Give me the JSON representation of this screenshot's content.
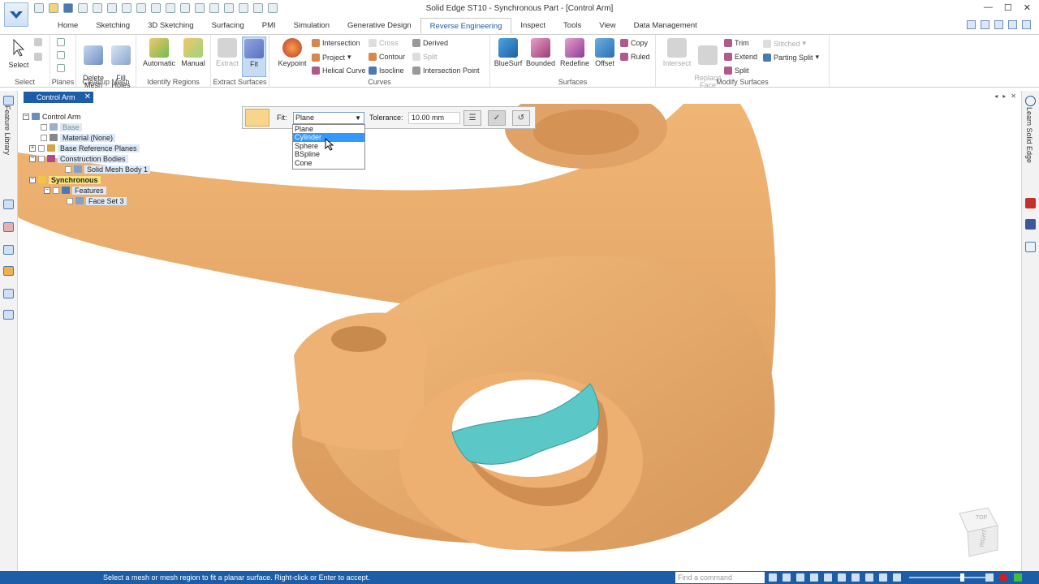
{
  "window": {
    "title": "Solid Edge ST10 - Synchronous Part - [Control Arm]",
    "controls": [
      "—",
      "☐",
      "✕"
    ]
  },
  "tabs": [
    "Home",
    "Sketching",
    "3D Sketching",
    "Surfacing",
    "PMI",
    "Simulation",
    "Generative Design",
    "Reverse Engineering",
    "Inspect",
    "Tools",
    "View",
    "Data Management"
  ],
  "active_tab": "Reverse Engineering",
  "ribbon": {
    "select": {
      "label": "Select",
      "group": "Select"
    },
    "planes": {
      "label": "Planes"
    },
    "cleanup": {
      "delete_mesh": "Delete\nMesh",
      "fill_holes": "Fill\nHoles",
      "group": "Cleanup Mesh"
    },
    "identify": {
      "automatic": "Automatic",
      "manual": "Manual",
      "group": "Identify Regions"
    },
    "extract": {
      "extract": "Extract",
      "fit": "Fit",
      "group": "Extract Surfaces"
    },
    "curves": {
      "keypoint": "Keypoint",
      "intersection": "Intersection",
      "project": "Project",
      "helical": "Helical Curve",
      "cross": "Cross",
      "contour": "Contour",
      "isocline": "Isocline",
      "derived": "Derived",
      "split": "Split",
      "intersection_point": "Intersection Point",
      "group": "Curves"
    },
    "surfaces": {
      "bluesurf": "BlueSurf",
      "bounded": "Bounded",
      "redefine": "Redefine",
      "offset": "Offset",
      "copy": "Copy",
      "ruled": "Ruled",
      "group": "Surfaces"
    },
    "modify": {
      "intersect": "Intersect",
      "replace_face": "Replace\nFace",
      "trim": "Trim",
      "extend": "Extend",
      "split": "Split",
      "stitched": "Stitched",
      "parting_split": "Parting Split",
      "group": "Modify Surfaces"
    }
  },
  "doc_tab": {
    "label": "Control Arm",
    "close": "✕"
  },
  "left_panel_label": "Feature Library",
  "right_panel_label": "Learn Solid Edge",
  "tree": [
    {
      "label": "Control Arm",
      "depth": 0
    },
    {
      "label": "Base",
      "depth": 1
    },
    {
      "label": "Material (None)",
      "depth": 1
    },
    {
      "label": "Base Reference Planes",
      "depth": 1
    },
    {
      "label": "Construction Bodies",
      "depth": 1
    },
    {
      "label": "Solid Mesh Body 1",
      "depth": 2
    },
    {
      "label": "Synchronous",
      "depth": 0
    },
    {
      "label": "Features",
      "depth": 1
    },
    {
      "label": "Face Set 3",
      "depth": 2
    }
  ],
  "command_bar": {
    "fit_label": "Fit:",
    "fit_value": "Plane",
    "tolerance_label": "Tolerance:",
    "tolerance_value": "10.00 mm"
  },
  "fit_options": [
    "Plane",
    "Cylinder",
    "Sphere",
    "BSpline",
    "Cone"
  ],
  "fit_highlighted": "Cylinder",
  "view_cube": {
    "top": "TOP",
    "right": "RIGHT"
  },
  "status": {
    "prompt": "Select a mesh or mesh region to fit a planar surface. Right-click or Enter to accept.",
    "find_placeholder": "Find a command"
  },
  "colors": {
    "accent": "#1d5da8",
    "model": "#e9a765",
    "model_shadow": "#c98a4e",
    "selected_region": "#5bc7c7"
  }
}
